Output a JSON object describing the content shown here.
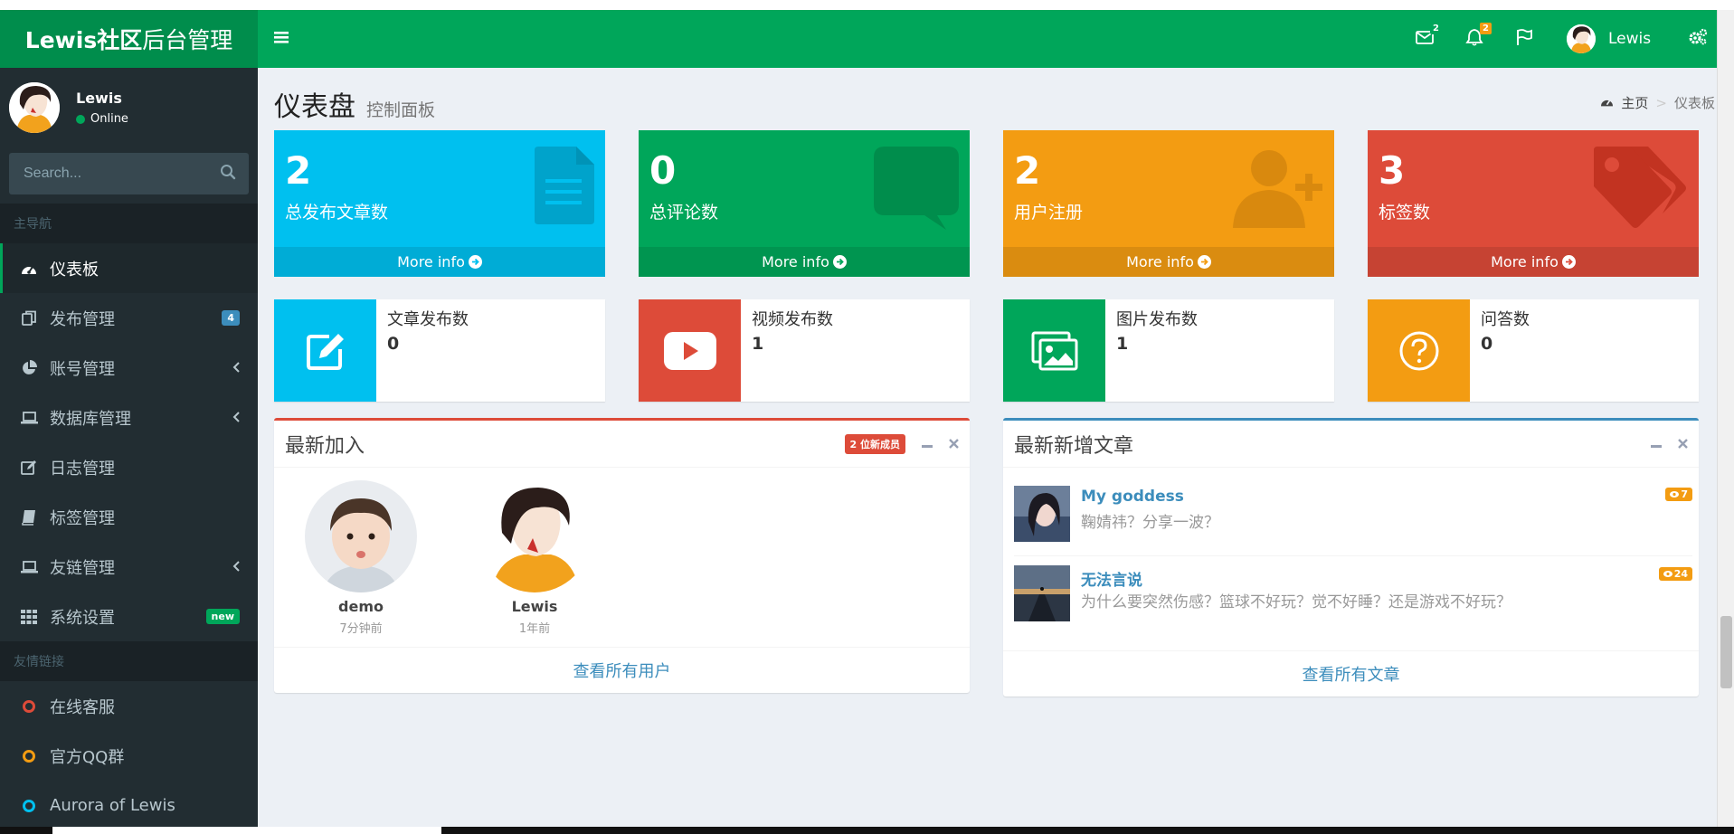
{
  "sidebar": {
    "logo_bold": "Lewis社区",
    "logo_rest": "后台管理",
    "user_name": "Lewis",
    "user_status": "Online",
    "search_placeholder": "Search...",
    "section_main": "主导航",
    "section_links": "友情链接",
    "items": [
      {
        "label": "仪表板",
        "icon": "dashboard-icon",
        "active": true
      },
      {
        "label": "发布管理",
        "icon": "copy-icon",
        "badge": "4"
      },
      {
        "label": "账号管理",
        "icon": "pie-chart-icon",
        "arrow": true
      },
      {
        "label": "数据库管理",
        "icon": "laptop-icon",
        "arrow": true
      },
      {
        "label": "日志管理",
        "icon": "edit-icon"
      },
      {
        "label": "标签管理",
        "icon": "book-icon"
      },
      {
        "label": "友链管理",
        "icon": "laptop-icon",
        "arrow": true
      },
      {
        "label": "系统设置",
        "icon": "grid-icon",
        "badge": "new"
      }
    ],
    "links": [
      {
        "label": "在线客服",
        "color": "#dd4b39"
      },
      {
        "label": "官方QQ群",
        "color": "#f39c12"
      },
      {
        "label": "Aurora of Lewis",
        "color": "#00c0ef"
      }
    ]
  },
  "navbar": {
    "mail_count": "2",
    "notif_count": "2",
    "user_name": "Lewis"
  },
  "header": {
    "title": "仪表盘",
    "subtitle": "控制面板",
    "breadcrumb_home": "主页",
    "breadcrumb_sep": ">",
    "breadcrumb_current": "仪表板"
  },
  "stats": [
    {
      "value": "2",
      "label": "总发布文章数",
      "more": "More info",
      "color": "#00c0ef",
      "icon": "document-icon"
    },
    {
      "value": "0",
      "label": "总评论数",
      "more": "More info",
      "color": "#00a65a",
      "icon": "comment-icon"
    },
    {
      "value": "2",
      "label": "用户注册",
      "more": "More info",
      "color": "#f39c12",
      "icon": "user-plus-icon"
    },
    {
      "value": "3",
      "label": "标签数",
      "more": "More info",
      "color": "#dd4b39",
      "icon": "tags-icon"
    }
  ],
  "infoboxes": [
    {
      "title": "文章发布数",
      "value": "0",
      "color": "#00c0ef",
      "icon": "edit-icon"
    },
    {
      "title": "视频发布数",
      "value": "1",
      "color": "#dd4b39",
      "icon": "youtube-icon"
    },
    {
      "title": "图片发布数",
      "value": "1",
      "color": "#00a65a",
      "icon": "images-icon"
    },
    {
      "title": "问答数",
      "value": "0",
      "color": "#f39c12",
      "icon": "question-icon"
    }
  ],
  "members_box": {
    "title": "最新加入",
    "badge": "2 位新成员",
    "footer": "查看所有用户",
    "members": [
      {
        "name": "demo",
        "time": "7分钟前"
      },
      {
        "name": "Lewis",
        "time": "1年前"
      }
    ]
  },
  "articles_box": {
    "title": "最新新增文章",
    "footer": "查看所有文章",
    "articles": [
      {
        "title": "My goddess",
        "desc": "鞠婧祎？分享一波？",
        "views": "7"
      },
      {
        "title": "无法言说",
        "desc": "为什么要突然伤感？篮球不好玩？觉不好睡？还是游戏不好玩？",
        "views": "24"
      }
    ]
  }
}
